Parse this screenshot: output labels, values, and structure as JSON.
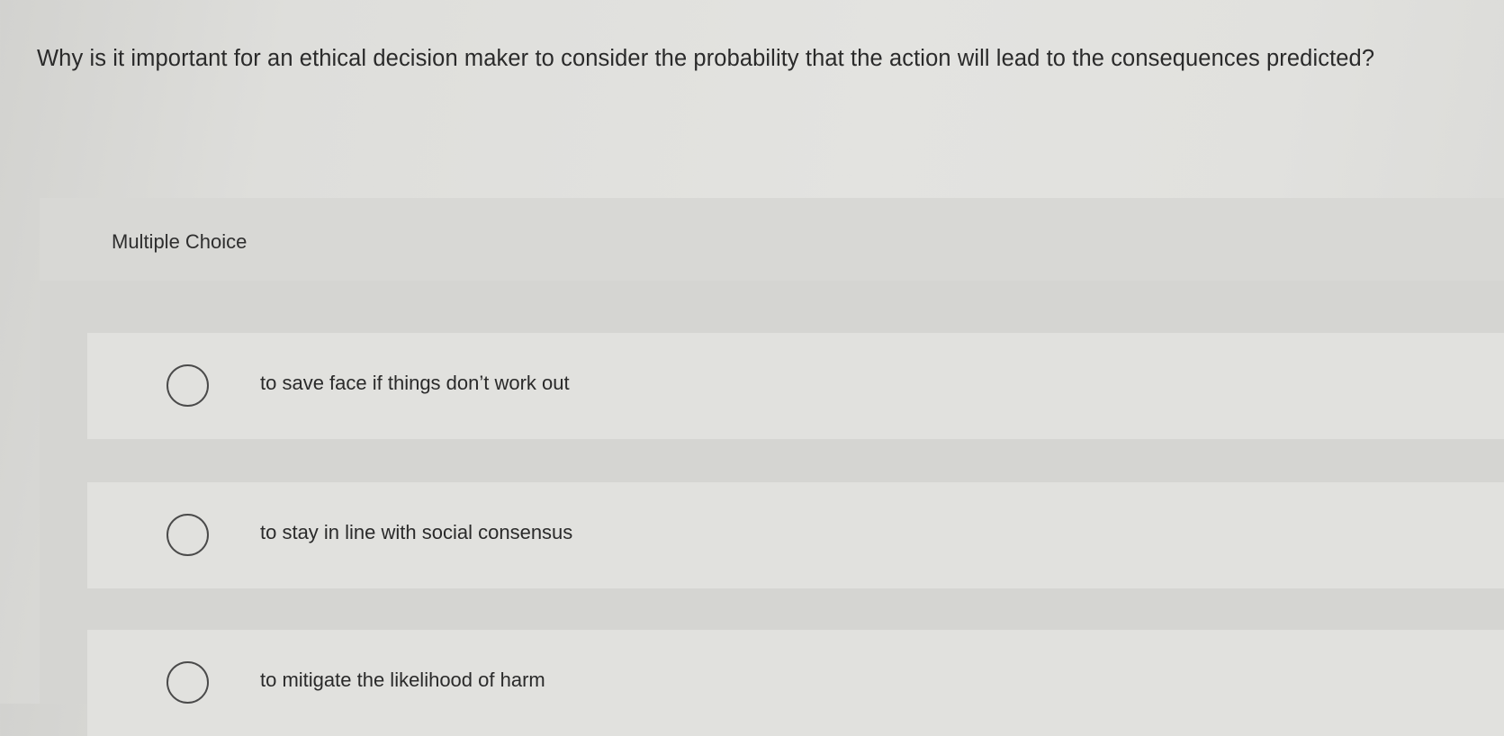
{
  "question": {
    "text": "Why is it important for an ethical decision maker to consider the probability that the action will lead to the consequences predicted?"
  },
  "panel": {
    "label": "Multiple Choice"
  },
  "options": [
    {
      "label": "to save face if things don’t work out",
      "selected": false
    },
    {
      "label": "to stay in line with social consensus",
      "selected": false
    },
    {
      "label": "to mitigate the likelihood of harm",
      "selected": false
    }
  ]
}
